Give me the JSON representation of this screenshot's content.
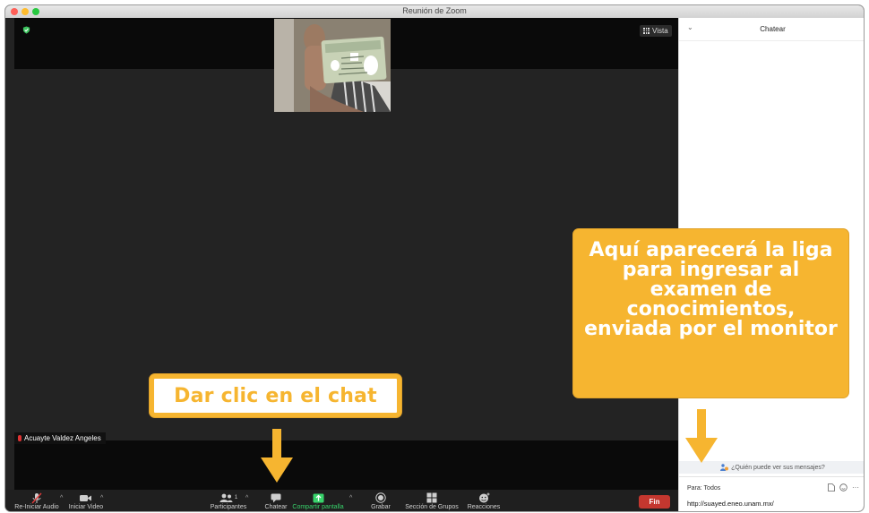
{
  "window": {
    "title": "Reunión de Zoom"
  },
  "video": {
    "view_button": "Vista",
    "participant_name": "Acuayte Valdez Angeles"
  },
  "toolbar": {
    "audio_label": "Re-Iniciar Audio",
    "video_label": "Iniciar Video",
    "participants_label": "Participantes",
    "participants_count": "1",
    "chat_label": "Chatear",
    "share_label": "Compartir pantalla",
    "record_label": "Grabar",
    "breakout_label": "Sección de Grupos",
    "reactions_label": "Reacciones",
    "end_label": "Fin",
    "share_color": "#38d36b",
    "end_color": "#c4372f"
  },
  "chat": {
    "title": "Chatear",
    "who_can_see": "¿Quién puede ver sus mensajes?",
    "to_label": "Para: Todos",
    "input_value": "http://suayed.eneo.unam.mx/"
  },
  "annotations": {
    "chat_hint": "Dar clic en el chat",
    "link_hint": "Aquí aparecerá la liga para ingresar al examen de conocimientos, enviada por el monitor",
    "accent_color": "#f6b530"
  },
  "icons": {
    "security": "shield-check-icon",
    "view": "grid-icon",
    "mic": "mic-muted-icon",
    "video": "video-camera-icon",
    "participants": "people-icon",
    "chat": "chat-bubble-icon",
    "share": "share-screen-icon",
    "record": "record-icon",
    "breakout": "breakout-rooms-icon",
    "reactions": "emoji-plus-icon"
  }
}
